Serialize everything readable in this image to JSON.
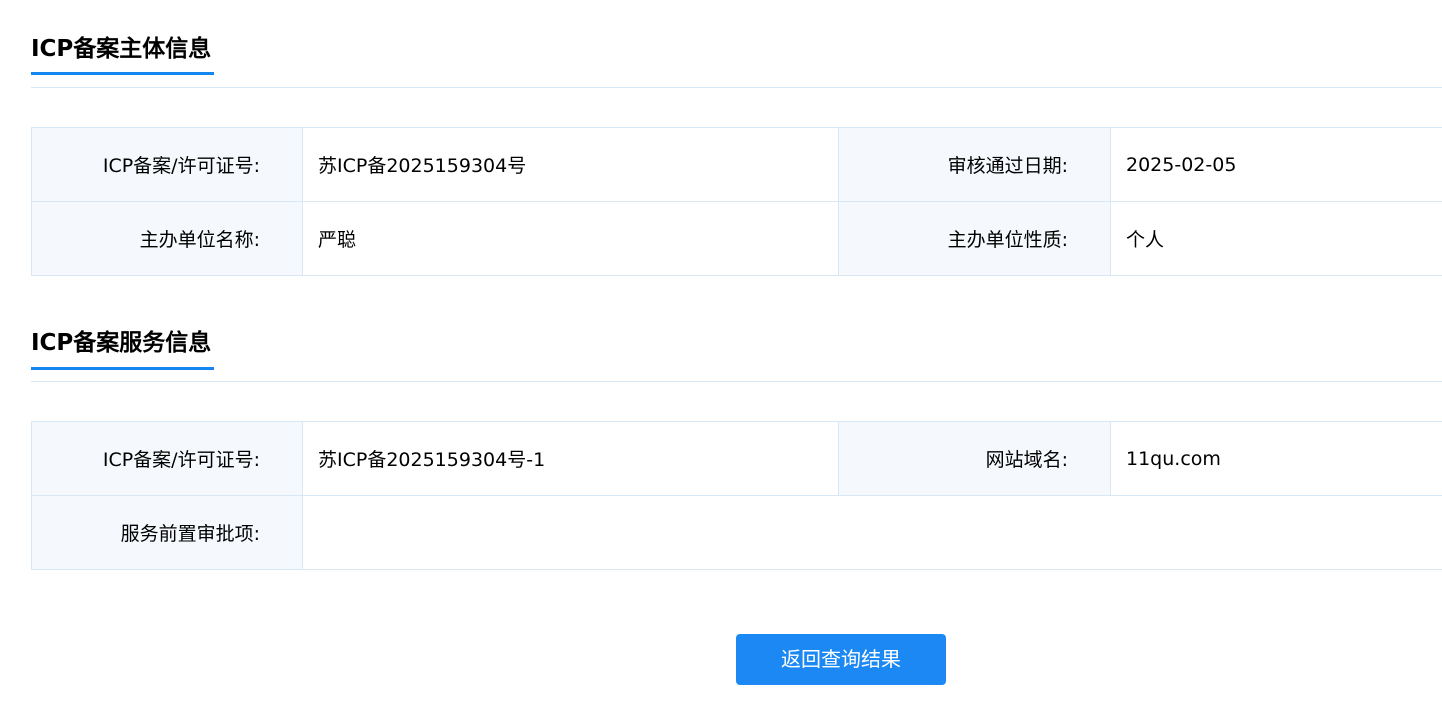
{
  "subject_section": {
    "title": "ICP备案主体信息",
    "rows": [
      {
        "label1": "ICP备案/许可证号:",
        "value1": "苏ICP备2025159304号",
        "label2": "审核通过日期:",
        "value2": "2025-02-05"
      },
      {
        "label1": "主办单位名称:",
        "value1": "严聪",
        "label2": "主办单位性质:",
        "value2": "个人"
      }
    ]
  },
  "service_section": {
    "title": "ICP备案服务信息",
    "row1": {
      "label1": "ICP备案/许可证号:",
      "value1": "苏ICP备2025159304号-1",
      "label2": "网站域名:",
      "value2": "11qu.com"
    },
    "row2": {
      "label": "服务前置审批项:",
      "value": ""
    }
  },
  "actions": {
    "return_label": "返回查询结果"
  },
  "colors": {
    "accent": "#1386f0",
    "button": "#1b88f4",
    "label_bg": "#f5f9fd",
    "border": "#d8e7f5"
  }
}
